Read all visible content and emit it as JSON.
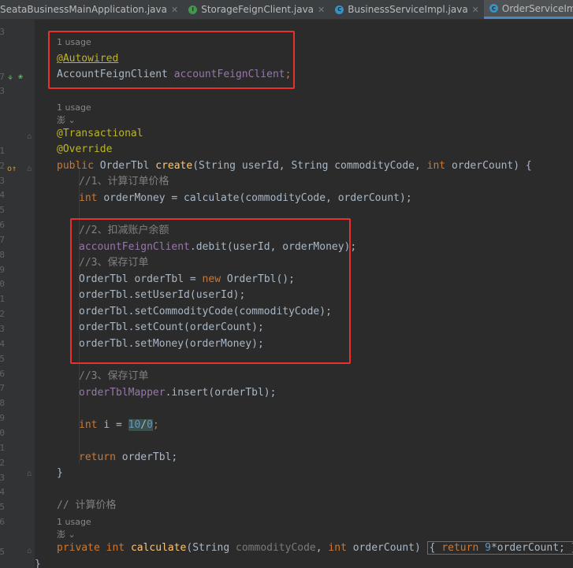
{
  "tabs": [
    {
      "label": "SeataBusinessMainApplication.java",
      "icon": "java-class-icon",
      "active": false
    },
    {
      "label": "StorageFeignClient.java",
      "icon": "interface-icon",
      "active": false
    },
    {
      "label": "BusinessServiceImpl.java",
      "icon": "class-icon",
      "active": false
    },
    {
      "label": "OrderServiceImpl.java",
      "icon": "class-icon",
      "active": true
    }
  ],
  "gutter": {
    "line_numbers": [
      "3",
      "",
      "",
      "7",
      "3",
      "",
      "",
      "",
      "1",
      "2",
      "3",
      "4",
      "5",
      "6",
      "7",
      "8",
      "9",
      "0",
      "1",
      "2",
      "3",
      "4",
      "5",
      "6",
      "7",
      "8",
      "9",
      "0",
      "1",
      "2",
      "3",
      "4",
      "5",
      "6",
      "",
      "5",
      ""
    ]
  },
  "code": {
    "l1_hint": "1 usage",
    "l1_annotation": "@Autowired",
    "l1_type": "AccountFeignClient ",
    "l1_field": "accountFeignClient",
    "l1_semi": ";",
    "l2_hint": "1 usage",
    "l2_author": "澎 ⌄",
    "l2_ann1": "@Transactional",
    "l2_ann2": "@Override",
    "sig_public": "public ",
    "sig_type": "OrderTbl ",
    "sig_name": "create",
    "sig_params_a": "(String userId, String commodityCode, ",
    "sig_int": "int ",
    "sig_params_b": "orderCount) {",
    "c1": "//1、计算订单价格",
    "m_int": "int ",
    "m_rest": "orderMoney = calculate(commodityCode, orderCount);",
    "c2": "//2、扣减账户余额",
    "debit_field": "accountFeignClient",
    "debit_rest": ".debit(userId, orderMoney);",
    "c3": "//3、保存订单",
    "new_a": "OrderTbl orderTbl = ",
    "new_kw": "new ",
    "new_b": "OrderTbl();",
    "set1": "orderTbl.setUserId(userId);",
    "set2": "orderTbl.setCommodityCode(commodityCode);",
    "set3": "orderTbl.setCount(orderCount);",
    "set4": "orderTbl.setMoney(orderMoney);",
    "c4": "//3、保存订单",
    "ins_field": "orderTblMapper",
    "ins_rest": ".insert(orderTbl);",
    "div_int": "int ",
    "div_a": "i = ",
    "div_num": "10",
    "div_slash": "/",
    "div_zero": "0",
    "div_semi": ";",
    "ret_kw": "return ",
    "ret_rest": "orderTbl;",
    "close1": "}",
    "c5": "// 计算价格",
    "l3_hint": "1 usage",
    "l3_author": "澎 ⌄",
    "calc_private": "private ",
    "calc_int": "int ",
    "calc_name": "calculate",
    "calc_a": "(String ",
    "calc_param": "commodityCode",
    "calc_b": ", ",
    "calc_int2": "int ",
    "calc_c": "orderCount) ",
    "calc_body_open": "{ ",
    "calc_return": "return ",
    "calc_num": "9",
    "calc_expr": "*orderCount; ",
    "calc_body_close": "}",
    "close_class": "}"
  },
  "colors": {
    "highlight_box": "#e8312e",
    "background": "#2b2b2b"
  }
}
